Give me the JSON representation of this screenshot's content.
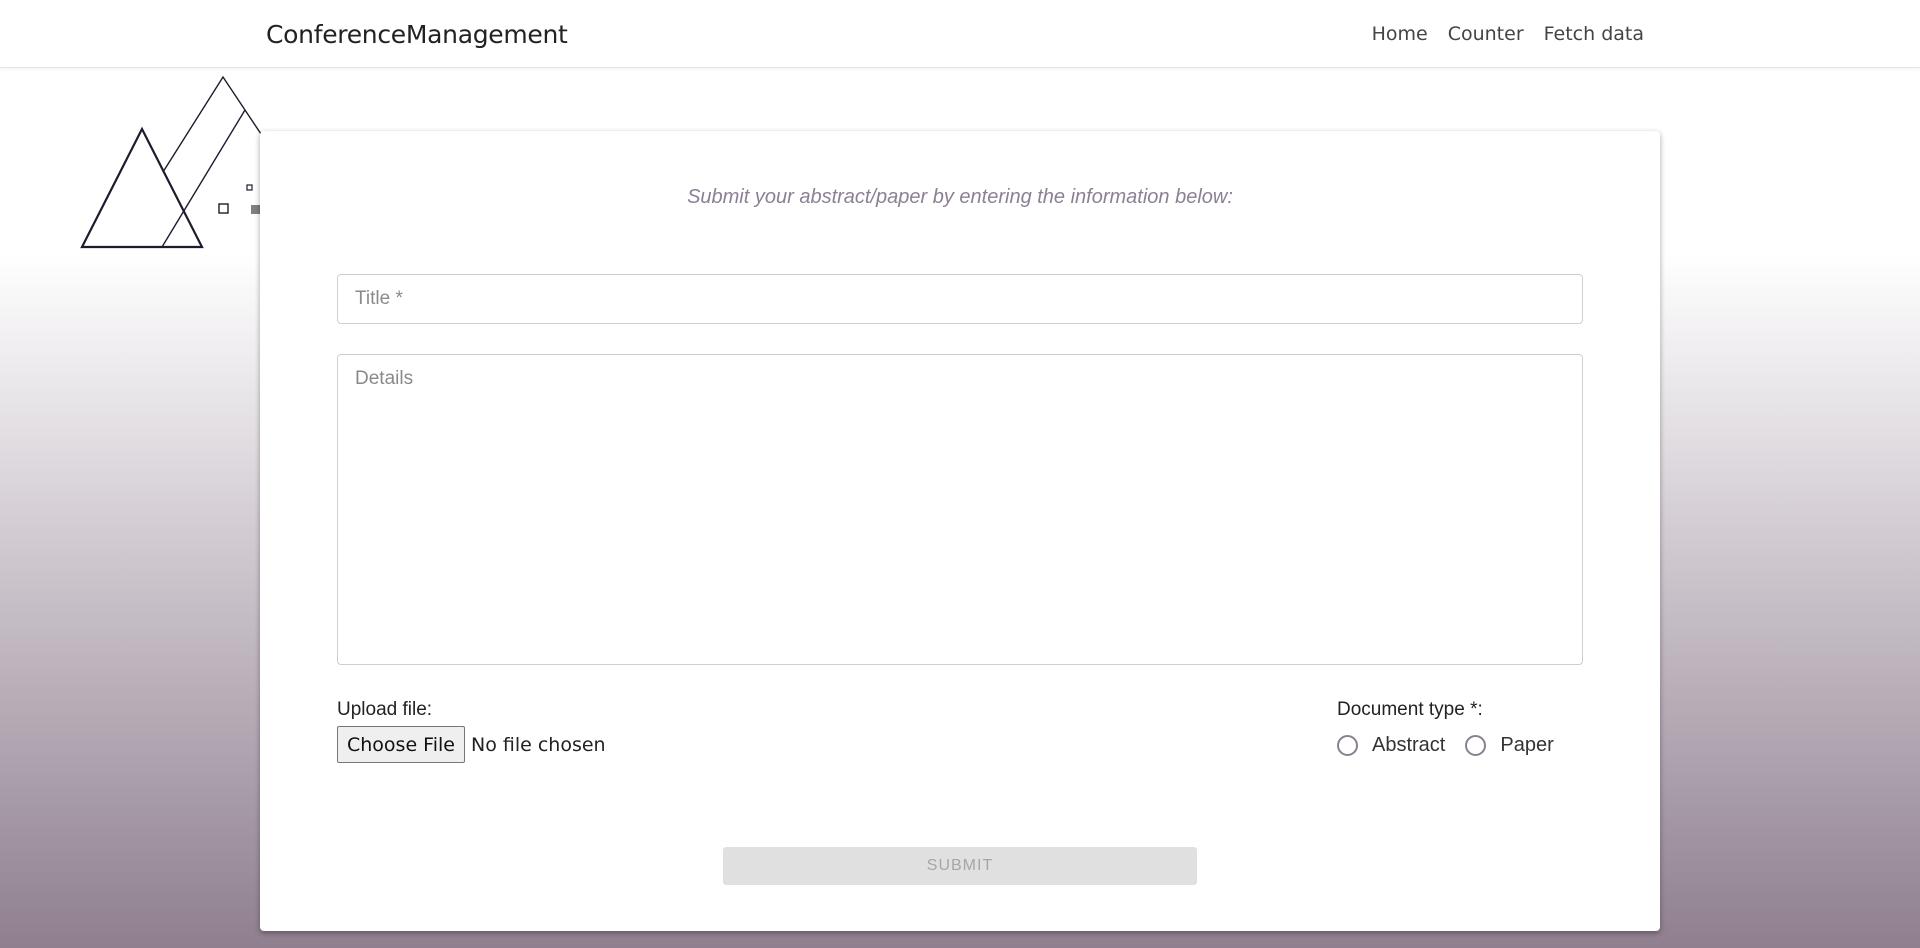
{
  "navbar": {
    "brand": "ConferenceManagement",
    "links": [
      "Home",
      "Counter",
      "Fetch data"
    ]
  },
  "form": {
    "intro": "Submit your abstract/paper by entering the information below:",
    "title_placeholder": "Title *",
    "details_placeholder": "Details",
    "upload_label": "Upload file:",
    "choose_file_label": "Choose File",
    "file_status": "No file chosen",
    "doctype_label": "Document type *:",
    "doctype_options": [
      "Abstract",
      "Paper"
    ],
    "submit_label": "SUBMIT"
  },
  "colors": {
    "gradient_bottom": "#8f7f8f",
    "intro_text": "#8c8094",
    "submit_bg": "#e0e0e0"
  }
}
